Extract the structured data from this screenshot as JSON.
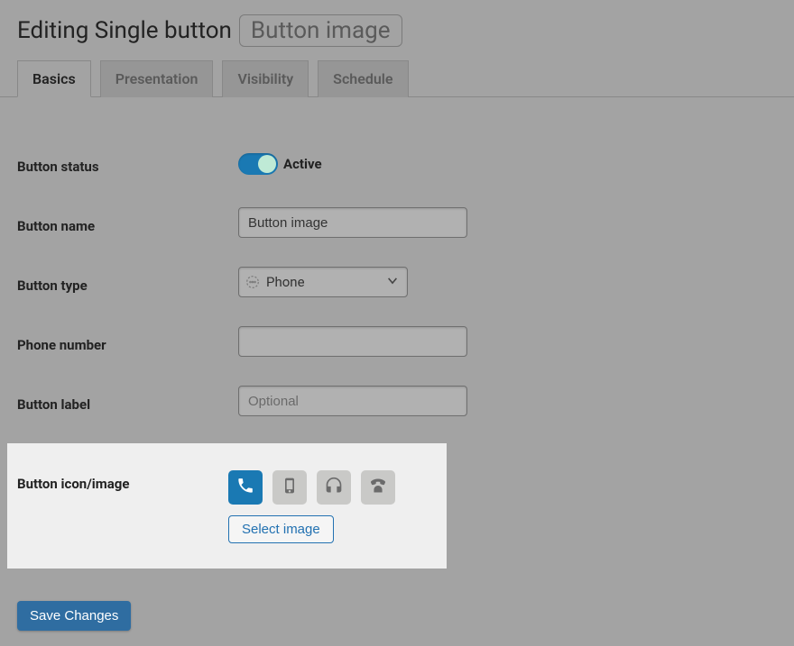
{
  "header": {
    "title_prefix": "Editing Single button",
    "badge": "Button image"
  },
  "tabs": [
    {
      "id": "basics",
      "label": "Basics",
      "active": true
    },
    {
      "id": "presentation",
      "label": "Presentation",
      "active": false
    },
    {
      "id": "visibility",
      "label": "Visibility",
      "active": false
    },
    {
      "id": "schedule",
      "label": "Schedule",
      "active": false
    }
  ],
  "fields": {
    "status": {
      "label": "Button status",
      "toggle_state": "on",
      "toggle_text": "Active"
    },
    "name": {
      "label": "Button name",
      "value": "Button image"
    },
    "type": {
      "label": "Button type",
      "value": "Phone"
    },
    "phone_number": {
      "label": "Phone number",
      "value": ""
    },
    "button_label": {
      "label": "Button label",
      "placeholder": "Optional",
      "value": ""
    },
    "icon_image": {
      "label": "Button icon/image",
      "select_image_label": "Select image",
      "icons": [
        {
          "name": "phone-icon",
          "selected": true
        },
        {
          "name": "mobile-icon",
          "selected": false
        },
        {
          "name": "headset-icon",
          "selected": false
        },
        {
          "name": "classic-phone-icon",
          "selected": false
        }
      ]
    }
  },
  "actions": {
    "save": "Save Changes"
  }
}
